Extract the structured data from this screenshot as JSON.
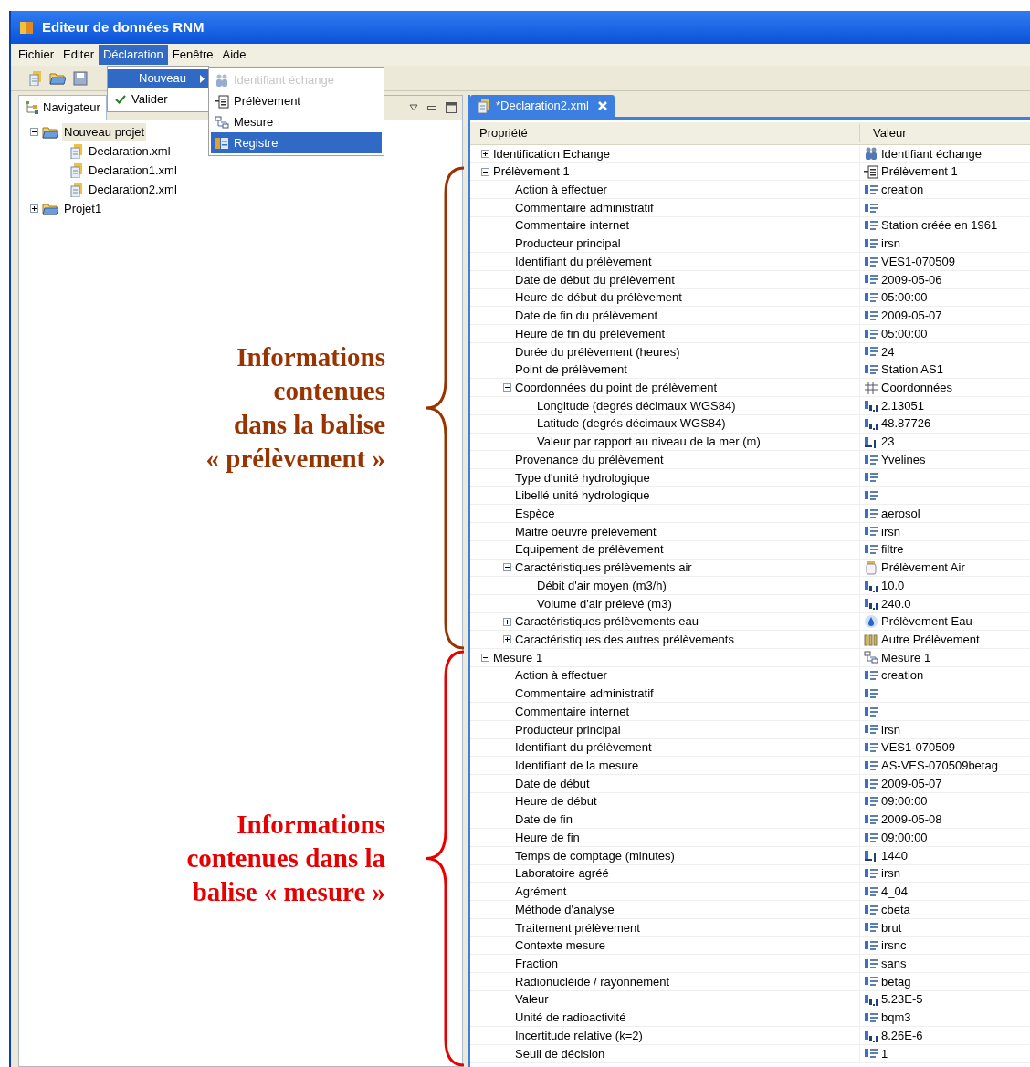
{
  "window": {
    "title": "Editeur de données RNM"
  },
  "menubar": [
    {
      "label": "Fichier",
      "selected": false
    },
    {
      "label": "Editer",
      "selected": false
    },
    {
      "label": "Déclaration",
      "selected": true
    },
    {
      "label": "Fenêtre",
      "selected": false
    },
    {
      "label": "Aide",
      "selected": false
    }
  ],
  "menu": {
    "items": [
      {
        "label": "Nouveau",
        "selected": true,
        "kind": "submenu"
      },
      {
        "label": "Valider",
        "selected": false,
        "kind": "check"
      }
    ],
    "submenu": [
      {
        "label": "Identifiant échange",
        "disabled": true,
        "selected": false,
        "kind": "exchange"
      },
      {
        "label": "Prélèvement",
        "disabled": false,
        "selected": false,
        "kind": "sample"
      },
      {
        "label": "Mesure",
        "disabled": false,
        "selected": false,
        "kind": "measure"
      },
      {
        "label": "Registre",
        "disabled": false,
        "selected": true,
        "kind": "register"
      }
    ]
  },
  "navigator": {
    "tab": "Navigateur",
    "tree": [
      {
        "label": "Nouveau projet",
        "expanded": true,
        "selected": true,
        "children": [
          {
            "label": "Declaration.xml"
          },
          {
            "label": "Declaration1.xml"
          },
          {
            "label": "Declaration2.xml"
          }
        ]
      },
      {
        "label": "Projet1",
        "expanded": false,
        "selected": false
      }
    ]
  },
  "editor": {
    "tab": "*Declaration2.xml",
    "columns": [
      "Propriété",
      "Valeur"
    ],
    "rows": [
      {
        "label": "Identification Echange",
        "value": "Identifiant échange",
        "kind": "exchange",
        "expanded": false
      },
      {
        "label": "Prélèvement 1",
        "value": "Prélèvement 1",
        "kind": "sample",
        "expanded": true,
        "children": [
          {
            "label": "Action à effectuer",
            "value": "creation",
            "kind": "text"
          },
          {
            "label": "Commentaire administratif",
            "kind": "text"
          },
          {
            "label": "Commentaire internet",
            "value": "Station créée en 1961",
            "kind": "text"
          },
          {
            "label": "Producteur principal",
            "value": "irsn",
            "kind": "text"
          },
          {
            "label": "Identifiant du prélèvement",
            "value": "VES1-070509",
            "kind": "text"
          },
          {
            "label": "Date de début du prélèvement",
            "value": "2009-05-06",
            "kind": "text"
          },
          {
            "label": "Heure de début du prélèvement",
            "value": "05:00:00",
            "kind": "text"
          },
          {
            "label": "Date de fin du prélèvement",
            "value": "2009-05-07",
            "kind": "text"
          },
          {
            "label": "Heure de fin du prélèvement",
            "value": "05:00:00",
            "kind": "text"
          },
          {
            "label": "Durée du prélèvement (heures)",
            "value": "24",
            "kind": "text"
          },
          {
            "label": "Point de prélèvement",
            "value": "Station AS1",
            "kind": "text"
          },
          {
            "label": "Coordonnées du point de prélèvement",
            "value": "Coordonnées",
            "kind": "coords",
            "expanded": true,
            "children": [
              {
                "label": "Longitude (degrés décimaux WGS84)",
                "value": "2.13051",
                "kind": "decimal"
              },
              {
                "label": "Latitude (degrés décimaux WGS84)",
                "value": "48.87726",
                "kind": "decimal"
              },
              {
                "label": "Valeur par rapport au niveau de la mer (m)",
                "value": "23",
                "kind": "integer"
              }
            ]
          },
          {
            "label": "Provenance du prélèvement",
            "value": "Yvelines",
            "kind": "text"
          },
          {
            "label": "Type d'unité hydrologique",
            "kind": "text"
          },
          {
            "label": "Libellé unité hydrologique",
            "kind": "text"
          },
          {
            "label": "Espèce",
            "value": "aerosol",
            "kind": "text"
          },
          {
            "label": "Maitre oeuvre prélèvement",
            "value": "irsn",
            "kind": "text"
          },
          {
            "label": "Equipement de prélèvement",
            "value": "filtre",
            "kind": "text"
          },
          {
            "label": "Caractéristiques prélèvements air",
            "value": "Prélèvement Air",
            "kind": "air",
            "expanded": true,
            "children": [
              {
                "label": "Débit d'air moyen (m3/h)",
                "value": "10.0",
                "kind": "decimal"
              },
              {
                "label": "Volume d'air prélevé (m3)",
                "value": "240.0",
                "kind": "decimal"
              }
            ]
          },
          {
            "label": "Caractéristiques prélèvements eau",
            "value": "Prélèvement Eau",
            "kind": "water",
            "expanded": false
          },
          {
            "label": "Caractéristiques des autres prélèvements",
            "value": "Autre Prélèvement",
            "kind": "other",
            "expanded": false
          }
        ]
      },
      {
        "label": "Mesure 1",
        "value": "Mesure 1",
        "kind": "measure",
        "expanded": true,
        "children": [
          {
            "label": "Action à effectuer",
            "value": "creation",
            "kind": "text"
          },
          {
            "label": "Commentaire administratif",
            "kind": "text"
          },
          {
            "label": "Commentaire internet",
            "kind": "text"
          },
          {
            "label": "Producteur principal",
            "value": "irsn",
            "kind": "text"
          },
          {
            "label": "Identifiant du prélèvement",
            "value": "VES1-070509",
            "kind": "text"
          },
          {
            "label": "Identifiant de la mesure",
            "value": "AS-VES-070509betag",
            "kind": "text"
          },
          {
            "label": "Date de début",
            "value": "2009-05-07",
            "kind": "text"
          },
          {
            "label": "Heure de début",
            "value": "09:00:00",
            "kind": "text"
          },
          {
            "label": "Date de fin",
            "value": "2009-05-08",
            "kind": "text"
          },
          {
            "label": "Heure de fin",
            "value": "09:00:00",
            "kind": "text"
          },
          {
            "label": "Temps de comptage (minutes)",
            "value": "1440",
            "kind": "integer"
          },
          {
            "label": "Laboratoire agréé",
            "value": "irsn",
            "kind": "text"
          },
          {
            "label": "Agrément",
            "value": "4_04",
            "kind": "text"
          },
          {
            "label": "Méthode d'analyse",
            "value": "cbeta",
            "kind": "text"
          },
          {
            "label": "Traitement prélèvement",
            "value": "brut",
            "kind": "text"
          },
          {
            "label": "Contexte mesure",
            "value": "irsnc",
            "kind": "text"
          },
          {
            "label": "Fraction",
            "value": "sans",
            "kind": "text"
          },
          {
            "label": "Radionucléide / rayonnement",
            "value": "betag",
            "kind": "text"
          },
          {
            "label": "Valeur",
            "value": "5.23E-5",
            "kind": "decimal"
          },
          {
            "label": "Unité de radioactivité",
            "value": "bqm3",
            "kind": "text"
          },
          {
            "label": "Incertitude relative (k=2)",
            "value": "8.26E-6",
            "kind": "decimal"
          },
          {
            "label": "Seuil de décision",
            "value": "1",
            "kind": "text"
          }
        ]
      }
    ]
  },
  "annotations": [
    {
      "lines": [
        "Informations",
        "contenues",
        "dans la balise",
        "« prélèvement »"
      ],
      "color": "#993300"
    },
    {
      "lines": [
        "Informations",
        "contenues dans la",
        "balise « mesure »"
      ],
      "color": "#e60000"
    }
  ]
}
